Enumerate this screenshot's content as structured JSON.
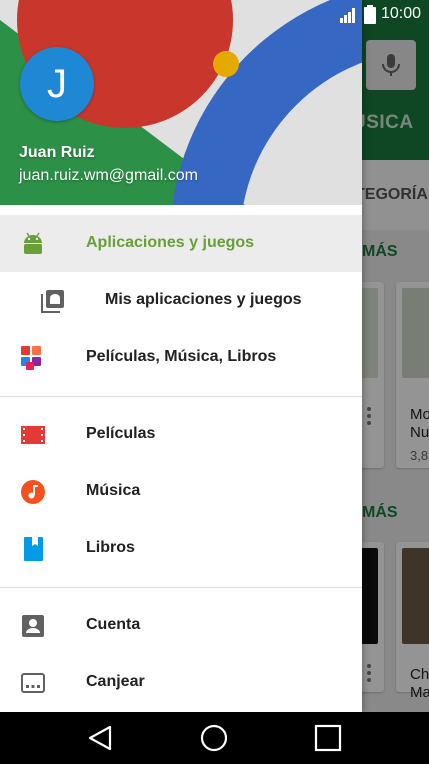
{
  "status_bar": {
    "time": "10:00"
  },
  "background": {
    "tab_label": "ÚSICA",
    "categories_label": "TEGORÍA",
    "section1_more": "MÁS",
    "section2_more": "MÁS",
    "card1_title_line1": "Mo",
    "card1_title_line2": "Nu",
    "card1_rating": "3,8",
    "card2_title_line1": "Ch",
    "card2_title_line2": "Ma"
  },
  "drawer": {
    "avatar_letter": "J",
    "user_name": "Juan Ruiz",
    "user_email": "juan.ruiz.wm@gmail.com",
    "items": [
      {
        "label": "Aplicaciones y juegos",
        "icon": "android-icon",
        "active": true
      },
      {
        "label": "Mis aplicaciones y juegos",
        "icon": "my-apps-icon"
      },
      {
        "label": "Películas, Música, Libros",
        "icon": "entertainment-icon"
      },
      {
        "label": "Películas",
        "icon": "movies-icon"
      },
      {
        "label": "Música",
        "icon": "music-icon"
      },
      {
        "label": "Libros",
        "icon": "books-icon"
      },
      {
        "label": "Cuenta",
        "icon": "account-icon"
      },
      {
        "label": "Canjear",
        "icon": "redeem-icon"
      }
    ]
  },
  "colors": {
    "accent_active": "#689f38",
    "avatar": "#1e88d4",
    "play_green": "#1b7a3e"
  },
  "navigation_bar": [
    "back-icon",
    "home-icon",
    "recents-icon"
  ]
}
